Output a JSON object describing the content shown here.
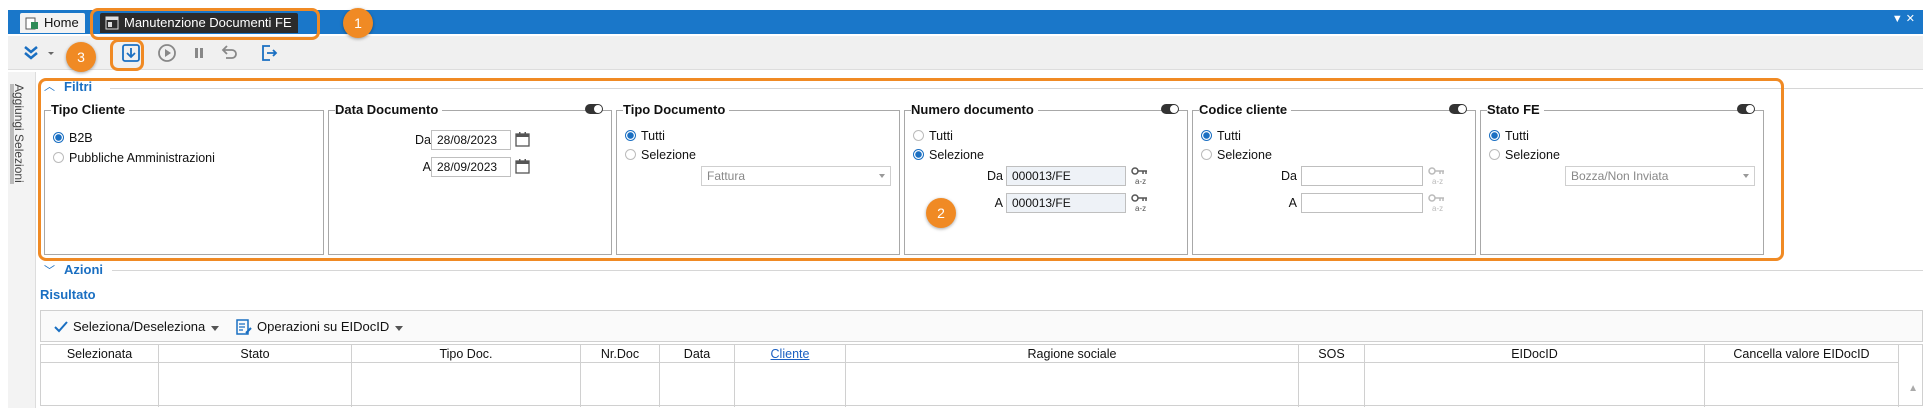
{
  "tabs": [
    {
      "label": "Home",
      "active": false
    },
    {
      "label": "Manutenzione Documenti FE",
      "active": true
    }
  ],
  "side_panel": {
    "label": "Aggiungi Selezioni"
  },
  "sections": {
    "filtri": "Filtri",
    "azioni": "Azioni",
    "risultato": "Risultato"
  },
  "filters": {
    "tipo_cliente": {
      "title": "Tipo Cliente",
      "options": [
        {
          "label": "B2B",
          "selected": true
        },
        {
          "label": "Pubbliche Amministrazioni",
          "selected": false
        }
      ]
    },
    "data_documento": {
      "title": "Data Documento",
      "from_label": "Da",
      "from_value": "28/08/2023",
      "to_label": "A",
      "to_value": "28/09/2023"
    },
    "tipo_documento": {
      "title": "Tipo Documento",
      "options": [
        {
          "label": "Tutti",
          "selected": true
        },
        {
          "label": "Selezione",
          "selected": false
        }
      ],
      "select_value": "Fattura"
    },
    "numero_documento": {
      "title": "Numero documento",
      "options": [
        {
          "label": "Tutti",
          "selected": false
        },
        {
          "label": "Selezione",
          "selected": true
        }
      ],
      "from_label": "Da",
      "from_value": "000013/FE",
      "to_label": "A",
      "to_value": "000013/FE"
    },
    "codice_cliente": {
      "title": "Codice cliente",
      "options": [
        {
          "label": "Tutti",
          "selected": true
        },
        {
          "label": "Selezione",
          "selected": false
        }
      ],
      "from_label": "Da",
      "from_value": "",
      "to_label": "A",
      "to_value": ""
    },
    "stato_fe": {
      "title": "Stato FE",
      "options": [
        {
          "label": "Tutti",
          "selected": true
        },
        {
          "label": "Selezione",
          "selected": false
        }
      ],
      "select_value": "Bozza/Non Inviata"
    }
  },
  "result_toolbar": {
    "select_toggle": "Seleziona/Deseleziona",
    "operations": "Operazioni su EIDocID"
  },
  "grid": {
    "columns": [
      "Selezionata",
      "Stato",
      "Tipo Doc.",
      "Nr.Doc",
      "Data",
      "Cliente",
      "Ragione sociale",
      "SOS",
      "EIDocID",
      "Cancella valore EIDocID"
    ]
  },
  "annotations": [
    "1",
    "2",
    "3"
  ],
  "colors": {
    "accent": "#1a77c9",
    "annotation": "#f08a24"
  }
}
